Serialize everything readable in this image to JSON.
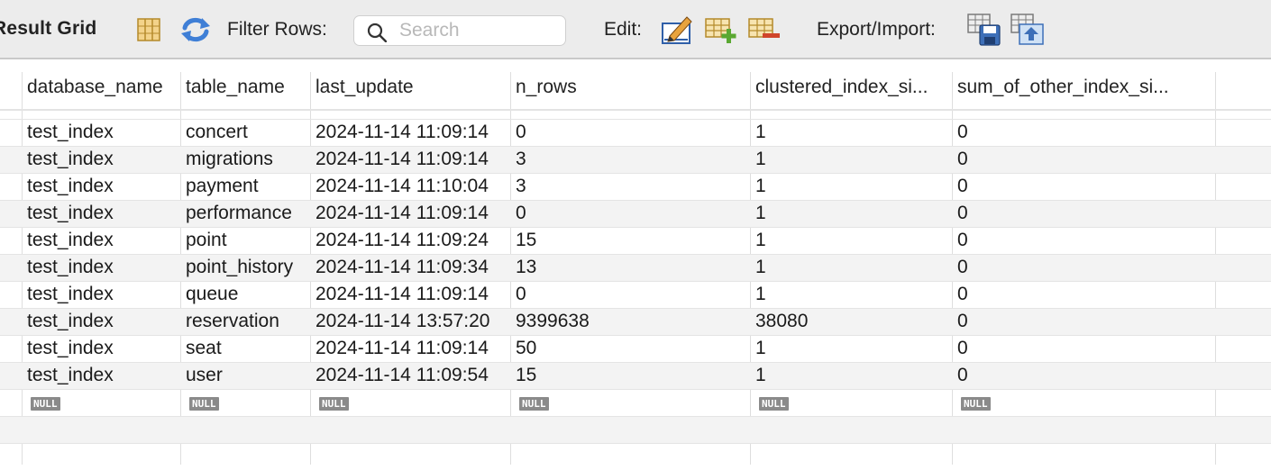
{
  "toolbar": {
    "title": "Result Grid",
    "filter_label": "Filter Rows:",
    "search_placeholder": "Search",
    "edit_label": "Edit:",
    "export_label": "Export/Import:"
  },
  "columns": [
    "database_name",
    "table_name",
    "last_update",
    "n_rows",
    "clustered_index_si...",
    "sum_of_other_index_si..."
  ],
  "rows": [
    {
      "database_name": "test_index",
      "table_name": "concert",
      "last_update": "2024-11-14 11:09:14",
      "n_rows": "0",
      "clustered_index_size": "1",
      "sum_of_other_index_sizes": "0"
    },
    {
      "database_name": "test_index",
      "table_name": "migrations",
      "last_update": "2024-11-14 11:09:14",
      "n_rows": "3",
      "clustered_index_size": "1",
      "sum_of_other_index_sizes": "0"
    },
    {
      "database_name": "test_index",
      "table_name": "payment",
      "last_update": "2024-11-14 11:10:04",
      "n_rows": "3",
      "clustered_index_size": "1",
      "sum_of_other_index_sizes": "0"
    },
    {
      "database_name": "test_index",
      "table_name": "performance",
      "last_update": "2024-11-14 11:09:14",
      "n_rows": "0",
      "clustered_index_size": "1",
      "sum_of_other_index_sizes": "0"
    },
    {
      "database_name": "test_index",
      "table_name": "point",
      "last_update": "2024-11-14 11:09:24",
      "n_rows": "15",
      "clustered_index_size": "1",
      "sum_of_other_index_sizes": "0"
    },
    {
      "database_name": "test_index",
      "table_name": "point_history",
      "last_update": "2024-11-14 11:09:34",
      "n_rows": "13",
      "clustered_index_size": "1",
      "sum_of_other_index_sizes": "0"
    },
    {
      "database_name": "test_index",
      "table_name": "queue",
      "last_update": "2024-11-14 11:09:14",
      "n_rows": "0",
      "clustered_index_size": "1",
      "sum_of_other_index_sizes": "0"
    },
    {
      "database_name": "test_index",
      "table_name": "reservation",
      "last_update": "2024-11-14 13:57:20",
      "n_rows": "9399638",
      "clustered_index_size": "38080",
      "sum_of_other_index_sizes": "0"
    },
    {
      "database_name": "test_index",
      "table_name": "seat",
      "last_update": "2024-11-14 11:09:14",
      "n_rows": "50",
      "clustered_index_size": "1",
      "sum_of_other_index_sizes": "0"
    },
    {
      "database_name": "test_index",
      "table_name": "user",
      "last_update": "2024-11-14 11:09:54",
      "n_rows": "15",
      "clustered_index_size": "1",
      "sum_of_other_index_sizes": "0"
    }
  ],
  "null_text": "NULL",
  "icons": {
    "columns": "column-toggle-icon",
    "refresh": "refresh-icon",
    "search": "search-icon",
    "edit": "pencil-edit-icon",
    "add_row": "add-row-icon",
    "delete_row": "delete-row-icon",
    "export": "export-save-icon",
    "import": "import-icon"
  },
  "colors": {
    "toolbar_bg": "#ececec",
    "alt_row": "#f3f3f3",
    "null_badge": "#8a8a8a",
    "refresh_blue": "#3f7fd6"
  }
}
